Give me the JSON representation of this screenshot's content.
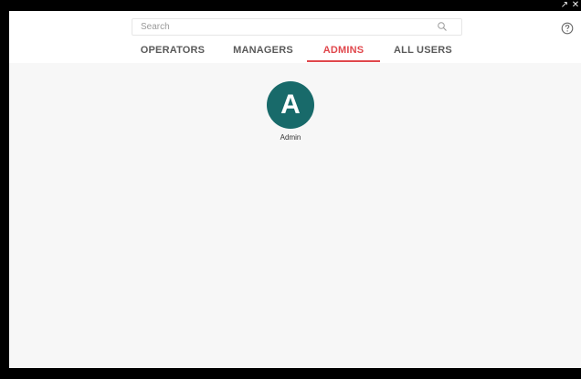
{
  "window": {
    "popout_icon": "popout-icon",
    "close_icon": "close-icon"
  },
  "search": {
    "placeholder": "Search",
    "value": "",
    "icon": "search-icon"
  },
  "help": {
    "icon": "help-icon"
  },
  "tabs": [
    {
      "label": "OPERATORS",
      "active": false
    },
    {
      "label": "MANAGERS",
      "active": false
    },
    {
      "label": "ADMINS",
      "active": true
    },
    {
      "label": "ALL USERS",
      "active": false
    }
  ],
  "users": [
    {
      "initial": "A",
      "name": "Admin",
      "avatar_color": "#186a6a"
    }
  ],
  "colors": {
    "accent": "#e0474c",
    "avatar": "#186a6a",
    "tab_text": "#5a5a5a"
  }
}
